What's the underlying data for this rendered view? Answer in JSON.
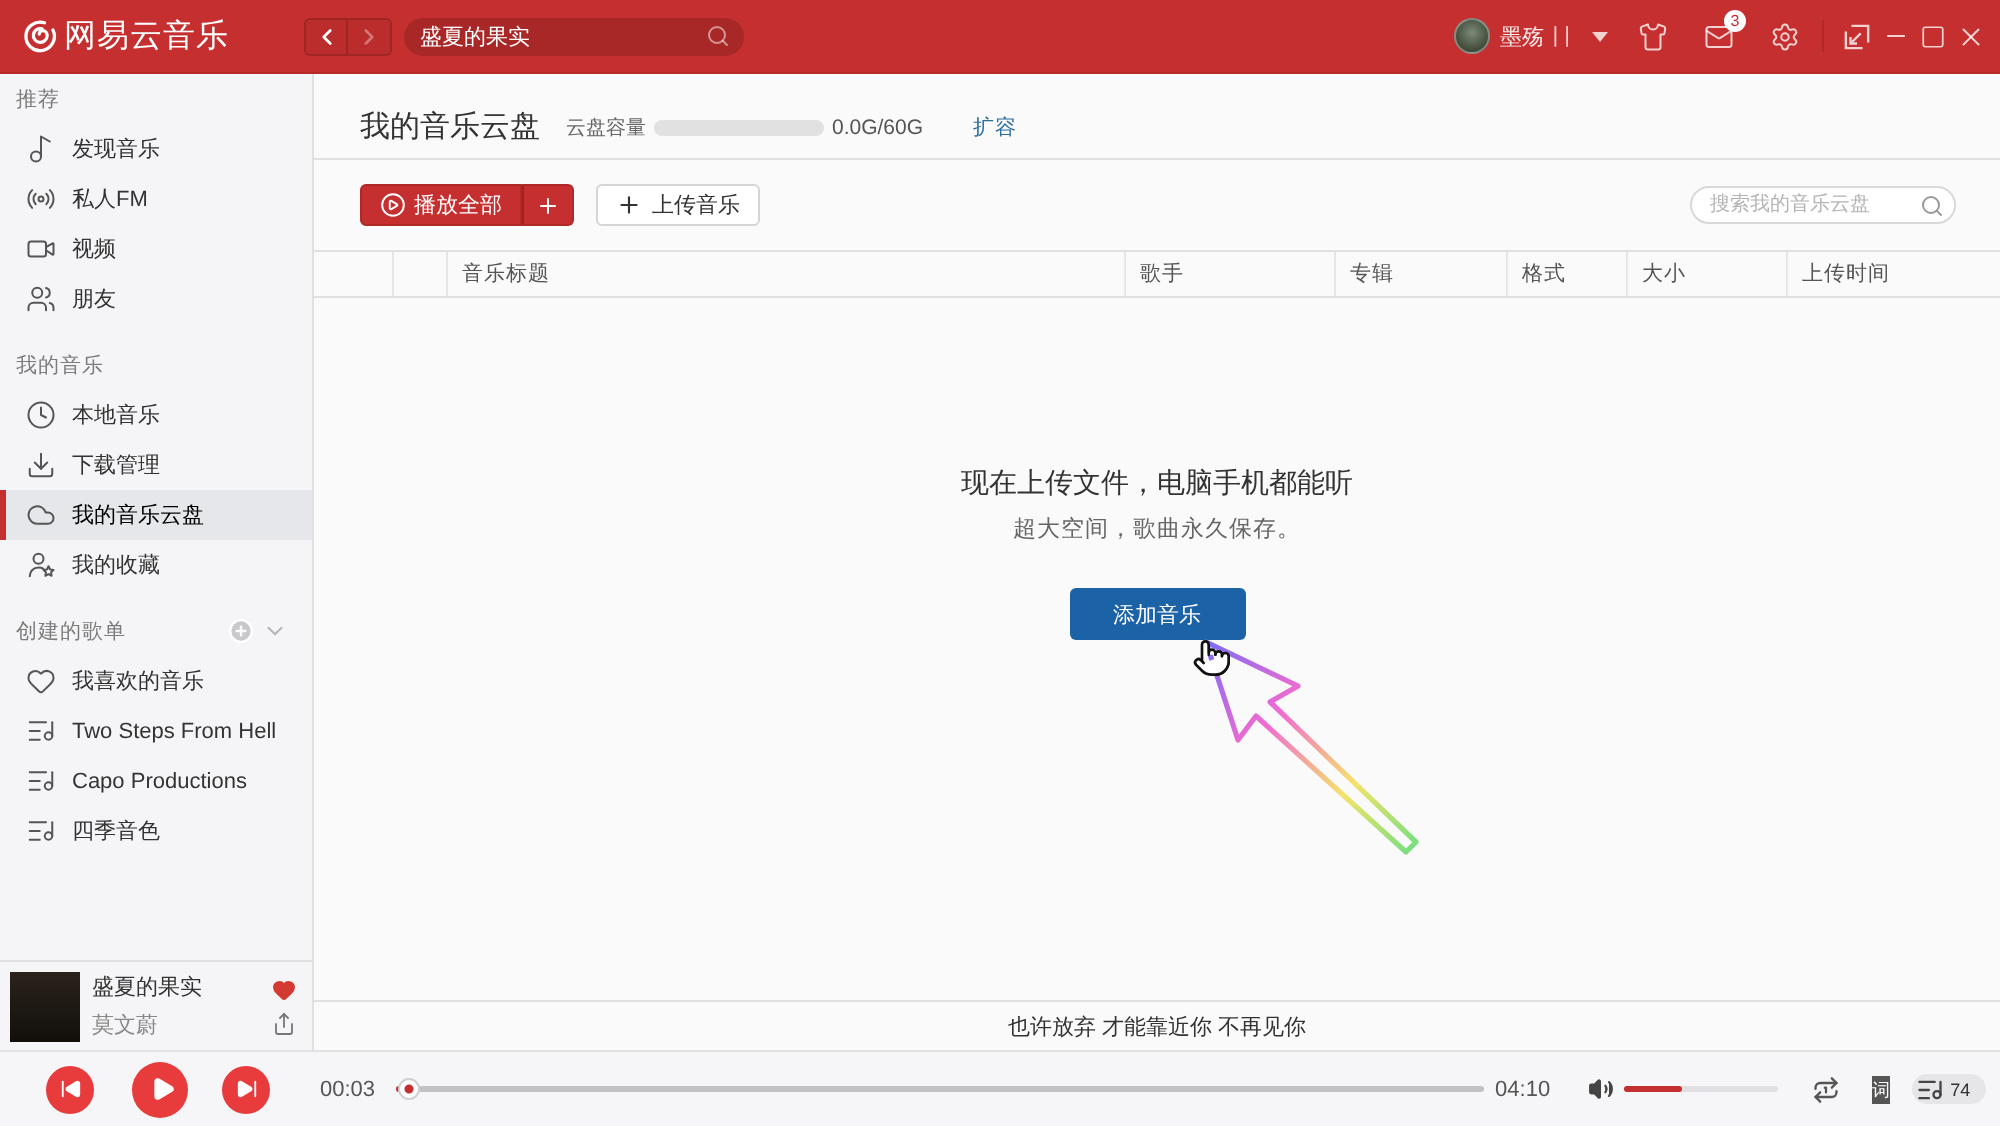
{
  "title_bar": {
    "app_name": "网易云音乐",
    "back": {
      "disabled": false
    },
    "forward": {
      "disabled": true
    },
    "search": {
      "value": "盛夏的果实"
    },
    "user": {
      "name": "墨殇",
      "tag": "| |"
    },
    "mail_badge": "3"
  },
  "sidebar": {
    "sections": [
      {
        "title": "推荐",
        "kind": "menu",
        "items": [
          {
            "label": "发现音乐",
            "kind": "music",
            "selected": false
          },
          {
            "label": "私人FM",
            "kind": "radio",
            "selected": false
          },
          {
            "label": "视频",
            "kind": "video",
            "selected": false
          },
          {
            "label": "朋友",
            "kind": "friends",
            "selected": false
          }
        ]
      },
      {
        "title": "我的音乐",
        "kind": "menu",
        "items": [
          {
            "label": "本地音乐",
            "kind": "local",
            "selected": false
          },
          {
            "label": "下载管理",
            "kind": "download",
            "selected": false
          },
          {
            "label": "我的音乐云盘",
            "kind": "cloud",
            "selected": true
          },
          {
            "label": "我的收藏",
            "kind": "collection",
            "selected": false
          }
        ]
      },
      {
        "title": "创建的歌单",
        "kind": "playlists",
        "items": [
          {
            "label": "我喜欢的音乐",
            "kind": "liked",
            "selected": false
          },
          {
            "label": "Two Steps From Hell",
            "kind": "playlist",
            "selected": false
          },
          {
            "label": "Capo Productions",
            "kind": "playlist",
            "selected": false
          },
          {
            "label": "四季音色",
            "kind": "playlist",
            "selected": false
          }
        ]
      }
    ]
  },
  "now_playing": {
    "title": "盛夏的果实",
    "artist": "莫文蔚",
    "liked": true
  },
  "page": {
    "title": "我的音乐云盘",
    "capacity": {
      "label": "云盘容量",
      "level": 0,
      "reading": "0.0G/60G"
    },
    "expand_link": "扩容",
    "play_all_button": "播放全部",
    "upload_button": "上传音乐",
    "search": {
      "placeholder": "搜索我的音乐云盘"
    },
    "table": {
      "columns": [
        "音乐标题",
        "歌手",
        "专辑",
        "格式",
        "大小",
        "上传时间"
      ]
    },
    "empty_state": {
      "heading": "现在上传文件，电脑手机都能听",
      "subtext": "超大空间，歌曲永久保存。",
      "button": "添加音乐"
    }
  },
  "lyric_bar": {
    "text": "也许放弃 才能靠近你 不再见你"
  },
  "player": {
    "elapsed": "00:03",
    "duration": "04:10",
    "progress": {
      "level": 0.012
    },
    "volume": {
      "level": 0.37
    },
    "lyrics_button": "词",
    "playlist_count": "74"
  }
}
